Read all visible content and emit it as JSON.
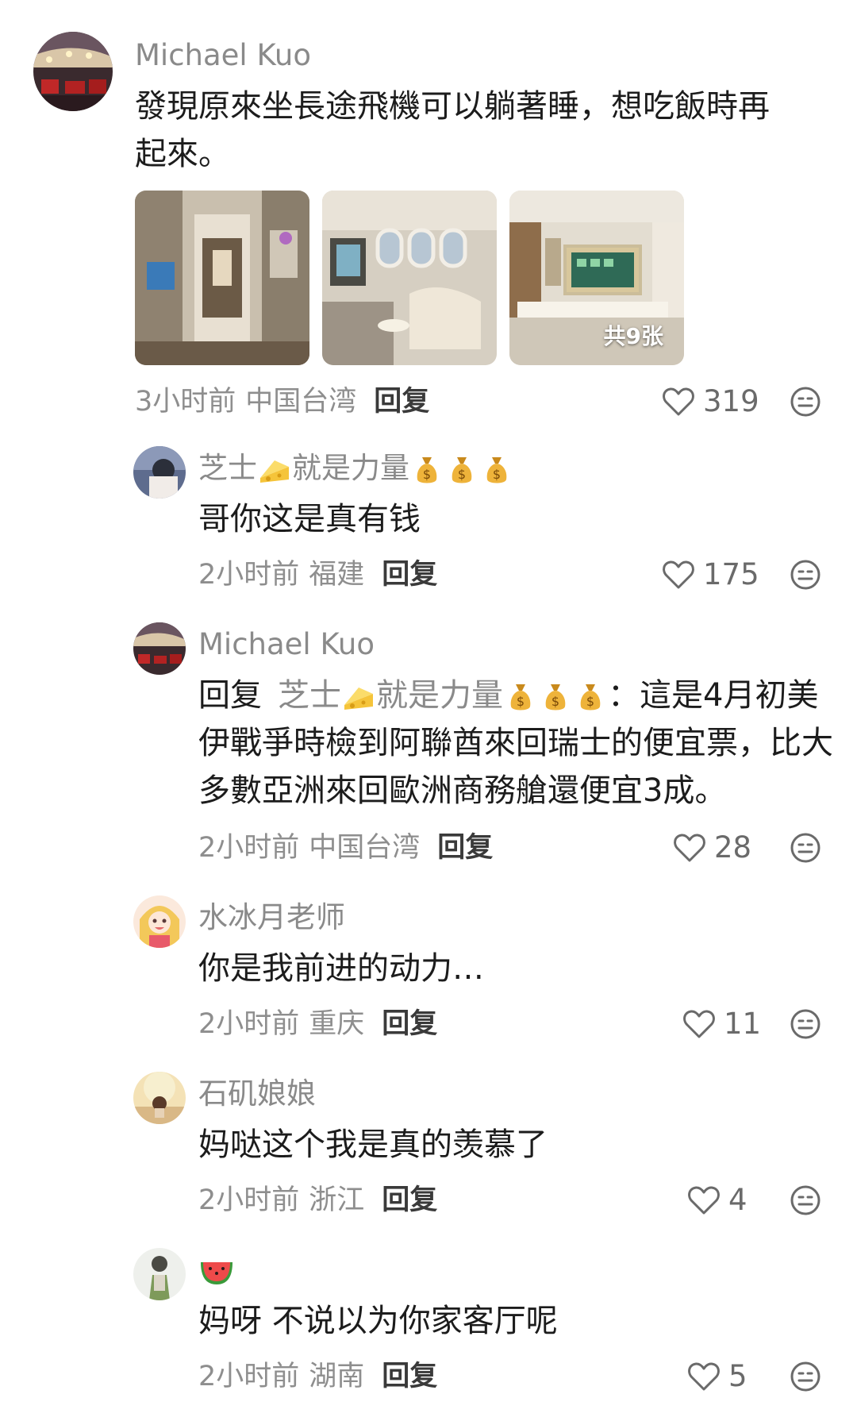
{
  "comments": [
    {
      "username": "Michael Kuo",
      "text": "發現原來坐長途飛機可以躺著睡，想吃飯時再起來。",
      "time": "3小时前",
      "location": "中国台湾",
      "reply_label": "回复",
      "likes": "319",
      "photos": [
        {
          "name": "cabin-aisle-photo"
        },
        {
          "name": "first-class-seat-photo"
        },
        {
          "name": "suite-screen-photo"
        }
      ],
      "photo_count": "共9张"
    },
    {
      "username": "芝士",
      "username_suffix": "就是力量",
      "text": "哥你这是真有钱",
      "time": "2小时前",
      "location": "福建",
      "reply_label": "回复",
      "likes": "175"
    },
    {
      "username": "Michael Kuo",
      "reply_prefix": "回复",
      "reply_target": "芝士",
      "reply_target_suffix": "就是力量",
      "text_colon": "：",
      "text_line1": "這是4月初美",
      "text_line2": "伊戰爭時檢到阿聯酋來回瑞士的便宜票，比大",
      "text_line3": "多數亞洲來回歐洲商務艙還便宜3成。",
      "time": "2小时前",
      "location": "中国台湾",
      "reply_label": "回复",
      "likes": "28"
    },
    {
      "username": "水冰月老师",
      "text": "你是我前进的动力…",
      "time": "2小时前",
      "location": "重庆",
      "reply_label": "回复",
      "likes": "11"
    },
    {
      "username": "石矶娘娘",
      "text": "妈哒这个我是真的羡慕了",
      "time": "2小时前",
      "location": "浙江",
      "reply_label": "回复",
      "likes": "4"
    },
    {
      "username_icon": "watermelon-icon",
      "text": "妈呀 不说以为你家客厅呢",
      "time": "2小时前",
      "location": "湖南",
      "reply_label": "回复",
      "likes": "5"
    }
  ],
  "icons": {
    "like": "heart-outline-icon",
    "react": "smiley-icon",
    "cheese": "cheese-icon",
    "money": "money-bag-icon"
  },
  "colors": {
    "username": "#8a8a8a",
    "body": "#1c1c1c",
    "meta": "#8e8e8e"
  }
}
